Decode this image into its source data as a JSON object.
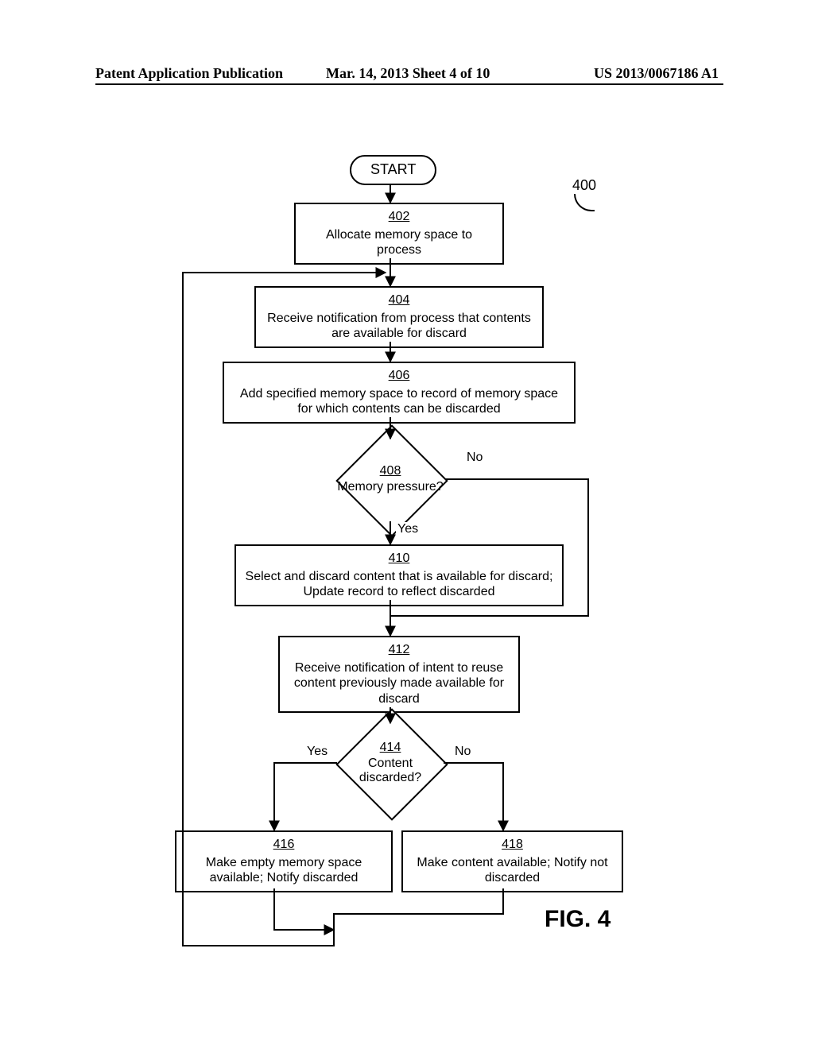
{
  "header": {
    "left": "Patent Application Publication",
    "mid": "Mar. 14, 2013  Sheet 4 of 10",
    "right": "US 2013/0067186 A1"
  },
  "figure": {
    "label": "FIG. 4",
    "overall_ref": "400"
  },
  "chart_data": {
    "type": "flowchart",
    "nodes": [
      {
        "id": "start",
        "kind": "terminator",
        "text": "START"
      },
      {
        "id": "402",
        "kind": "process",
        "ref": "402",
        "text": "Allocate memory space to process"
      },
      {
        "id": "404",
        "kind": "process",
        "ref": "404",
        "text": "Receive notification from process that contents are available for discard"
      },
      {
        "id": "406",
        "kind": "process",
        "ref": "406",
        "text": "Add specified memory space to record of memory space for which contents can be discarded"
      },
      {
        "id": "408",
        "kind": "decision",
        "ref": "408",
        "text": "Memory pressure?"
      },
      {
        "id": "410",
        "kind": "process",
        "ref": "410",
        "text": "Select and discard content that is available for discard; Update record to reflect discarded"
      },
      {
        "id": "412",
        "kind": "process",
        "ref": "412",
        "text": "Receive notification of intent to reuse content previously made available for discard"
      },
      {
        "id": "414",
        "kind": "decision",
        "ref": "414",
        "text": "Content discarded?"
      },
      {
        "id": "416",
        "kind": "process",
        "ref": "416",
        "text": "Make empty memory space available; Notify discarded"
      },
      {
        "id": "418",
        "kind": "process",
        "ref": "418",
        "text": "Make content available; Notify not discarded"
      }
    ],
    "edges": [
      {
        "from": "start",
        "to": "402"
      },
      {
        "from": "402",
        "to": "404"
      },
      {
        "from": "404",
        "to": "406"
      },
      {
        "from": "406",
        "to": "408"
      },
      {
        "from": "408",
        "to": "410",
        "label": "Yes"
      },
      {
        "from": "408",
        "to": "412",
        "label": "No",
        "route": "right-down"
      },
      {
        "from": "410",
        "to": "412"
      },
      {
        "from": "412",
        "to": "414"
      },
      {
        "from": "414",
        "to": "416",
        "label": "Yes"
      },
      {
        "from": "414",
        "to": "418",
        "label": "No"
      },
      {
        "from": "416",
        "to": "404",
        "route": "down-left-up"
      },
      {
        "from": "418",
        "to": "404",
        "route": "down-left-up"
      }
    ]
  }
}
